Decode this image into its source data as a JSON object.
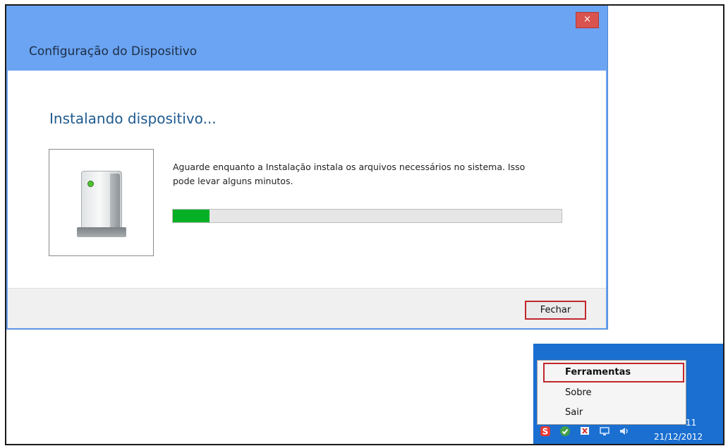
{
  "dialog": {
    "title": "Configuração do Dispositivo",
    "close_glyph": "×",
    "heading": "Instalando dispositivo...",
    "description_line1": "Aguarde enquanto a Instalação instala os arquivos necessários no sistema. Isso",
    "description_line2": "pode levar alguns minutos.",
    "progress_fraction": 0.095,
    "progress_color": "#06b025",
    "close_button_label": "Fechar",
    "device_icon": "external-drive-icon"
  },
  "context_menu": {
    "items": [
      {
        "label": "Ferramentas",
        "bold": true
      },
      {
        "label": "Sobre",
        "bold": false
      },
      {
        "label": "Sair",
        "bold": false
      }
    ]
  },
  "taskbar": {
    "tray_icons": [
      "s-app-icon",
      "shield-check-icon",
      "flag-error-icon",
      "network-icon",
      "speaker-icon"
    ],
    "clock_time_fragment": "11",
    "clock_date": "21/12/2012",
    "accent_color": "#1a6fd0"
  }
}
